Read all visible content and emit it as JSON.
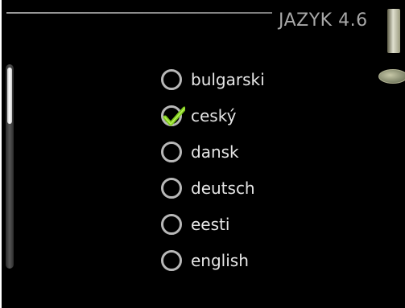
{
  "header": {
    "title": "JAZYK 4.6"
  },
  "languages": [
    {
      "label": "bulgarski",
      "selected": false
    },
    {
      "label": "ceský",
      "selected": true
    },
    {
      "label": "dansk",
      "selected": false
    },
    {
      "label": "deutsch",
      "selected": false
    },
    {
      "label": "eesti",
      "selected": false
    },
    {
      "label": "english",
      "selected": false
    }
  ],
  "colors": {
    "background": "#000000",
    "text": "#e6e6e6",
    "radio_ring": "#b8b8b8",
    "check_green": "#7ecb1b"
  },
  "icons": {
    "selected": "checkmark-icon",
    "unselected": "radio-circle-icon",
    "control_knob": "control-knob-icon",
    "scrollbar": "scrollbar"
  }
}
